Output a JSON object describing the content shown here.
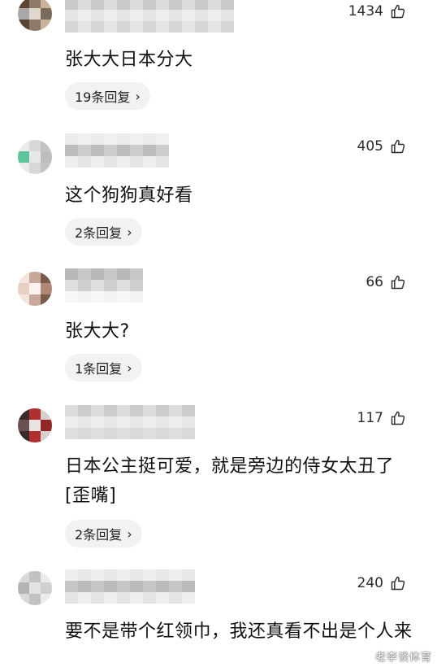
{
  "comments": [
    {
      "text": "张大大日本分大",
      "likes": "1434",
      "replies": "19条回复",
      "avatar_colors": [
        "#5b4433",
        "#8b7a6a",
        "#c8b29a",
        "#a9a9a9",
        "#e0d8cc",
        "#7a6b5a"
      ],
      "mosaic_colors": [
        "#c9c9c9",
        "#e6e6e6",
        "#b5b5b5",
        "#dcdcdc",
        "#efefef",
        "#cfcfcf"
      ]
    },
    {
      "text": "这个狗狗真好看",
      "likes": "405",
      "replies": "2条回复",
      "avatar_colors": [
        "#ececec",
        "#d7d7d7",
        "#c3c3c3",
        "#5ec49a",
        "#e8e8e8",
        "#bdbdbd"
      ],
      "mosaic_colors": [
        "#d2d2d2",
        "#ebebeb",
        "#bcbcbc",
        "#e1e1e1",
        "#f1f1f1",
        "#cccccc"
      ]
    },
    {
      "text": "张大大?",
      "likes": "66",
      "replies": "1条回复",
      "avatar_colors": [
        "#f4e4dc",
        "#c8a89a",
        "#7a5a4a",
        "#e8cfc4",
        "#fbf2ee",
        "#b08878"
      ],
      "mosaic_colors": [
        "#cfcfcf",
        "#e9e9e9",
        "#b8b8b8",
        "#dedede",
        "#f0f0f0",
        "#c7c7c7"
      ]
    },
    {
      "text": "日本公主挺可爱，就是旁边的侍女太丑了[歪嘴]",
      "likes": "117",
      "replies": "2条回复",
      "avatar_colors": [
        "#3a2a2a",
        "#b03030",
        "#d8d0cc",
        "#6a5050",
        "#e9e4e2",
        "#902828"
      ],
      "mosaic_colors": [
        "#cccccc",
        "#e7e7e7",
        "#b9b9b9",
        "#dddddd",
        "#eeeeee",
        "#c4c4c4"
      ]
    },
    {
      "text": "要不是带个红领巾，我还真看不出是个人来",
      "likes": "240",
      "replies": "",
      "avatar_colors": [
        "#d9d9d9",
        "#c2c2c2",
        "#ebebeb",
        "#b3b3b3",
        "#e2e2e2",
        "#cfcfcf"
      ],
      "mosaic_colors": [
        "#cdcdcd",
        "#e8e8e8",
        "#bababa",
        "#dfdfdf",
        "#efefef",
        "#c6c6c6"
      ]
    }
  ],
  "like_icon": "thumbs-up-icon",
  "chevron_icon": "chevron-right-icon",
  "watermark": "老李谈体育"
}
